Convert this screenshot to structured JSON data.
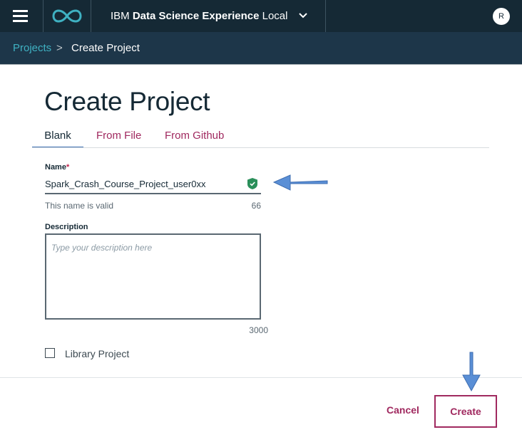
{
  "header": {
    "brand_prefix": "IBM",
    "brand_bold": "Data Science Experience",
    "brand_suffix": "Local",
    "avatar_initial": "R",
    "colors": {
      "bar": "#152935",
      "logo": "#3fb1c2"
    }
  },
  "breadcrumb": {
    "root": "Projects",
    "separator": ">",
    "current": "Create Project"
  },
  "page": {
    "title": "Create Project",
    "tabs": [
      {
        "label": "Blank",
        "active": true
      },
      {
        "label": "From File",
        "active": false
      },
      {
        "label": "From Github",
        "active": false
      }
    ]
  },
  "form": {
    "name_label": "Name",
    "required_mark": "*",
    "name_value": "Spark_Crash_Course_Project_user0xx",
    "name_valid_icon": "check-shield-icon",
    "name_hint": "This name is valid",
    "name_remaining": "66",
    "description_label": "Description",
    "description_placeholder": "Type your description here",
    "description_remaining": "3000",
    "library_project_label": "Library Project",
    "library_project_checked": false
  },
  "footer": {
    "cancel_label": "Cancel",
    "create_label": "Create",
    "accent": "#a0295f"
  }
}
